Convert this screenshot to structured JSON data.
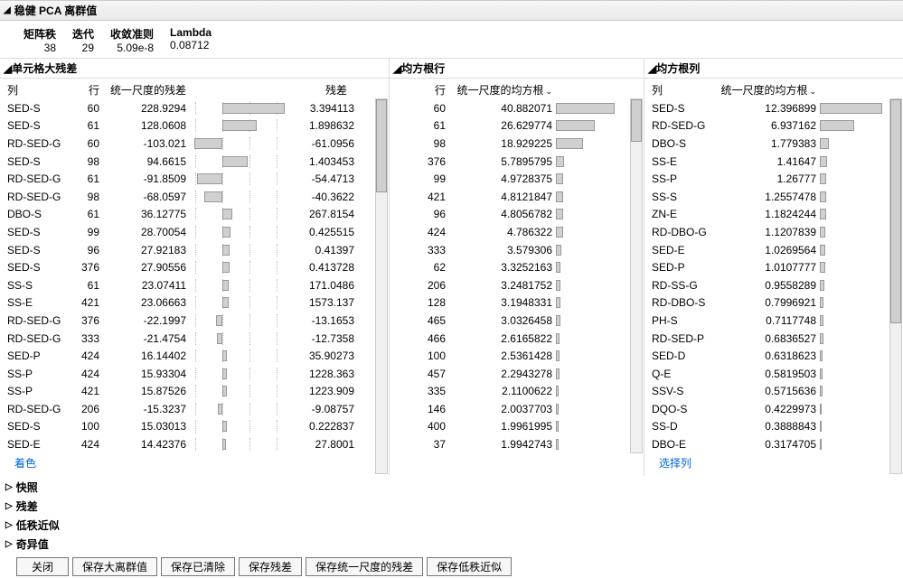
{
  "title": "稳健 PCA 离群值",
  "stats": {
    "matrix_rank_label": "矩阵秩",
    "iter_label": "迭代",
    "conv_label": "收敛准则",
    "lambda_label": "Lambda",
    "matrix_rank": "38",
    "iter": "29",
    "conv": "5.09e-8",
    "lambda": "0.08712"
  },
  "sectionA": {
    "header": "单元格大残差",
    "col1": "列",
    "col2": "行",
    "col3": "统一尺度的残差",
    "col4": "残差",
    "footer_link": "着色",
    "rows": [
      {
        "c": "SED-S",
        "r": "60",
        "v": "228.9294",
        "res": "3.394113"
      },
      {
        "c": "SED-S",
        "r": "61",
        "v": "128.0608",
        "res": "1.898632"
      },
      {
        "c": "RD-SED-G",
        "r": "60",
        "v": "-103.021",
        "res": "-61.0956"
      },
      {
        "c": "SED-S",
        "r": "98",
        "v": "94.6615",
        "res": "1.403453"
      },
      {
        "c": "RD-SED-G",
        "r": "61",
        "v": "-91.8509",
        "res": "-54.4713"
      },
      {
        "c": "RD-SED-G",
        "r": "98",
        "v": "-68.0597",
        "res": "-40.3622"
      },
      {
        "c": "DBO-S",
        "r": "61",
        "v": "36.12775",
        "res": "267.8154"
      },
      {
        "c": "SED-S",
        "r": "99",
        "v": "28.70054",
        "res": "0.425515"
      },
      {
        "c": "SED-S",
        "r": "96",
        "v": "27.92183",
        "res": "0.41397"
      },
      {
        "c": "SED-S",
        "r": "376",
        "v": "27.90556",
        "res": "0.413728"
      },
      {
        "c": "SS-S",
        "r": "61",
        "v": "23.07411",
        "res": "171.0486"
      },
      {
        "c": "SS-E",
        "r": "421",
        "v": "23.06663",
        "res": "1573.137"
      },
      {
        "c": "RD-SED-G",
        "r": "376",
        "v": "-22.1997",
        "res": "-13.1653"
      },
      {
        "c": "RD-SED-G",
        "r": "333",
        "v": "-21.4754",
        "res": "-12.7358"
      },
      {
        "c": "SED-P",
        "r": "424",
        "v": "16.14402",
        "res": "35.90273"
      },
      {
        "c": "SS-P",
        "r": "424",
        "v": "15.93304",
        "res": "1228.363"
      },
      {
        "c": "SS-P",
        "r": "421",
        "v": "15.87526",
        "res": "1223.909"
      },
      {
        "c": "RD-SED-G",
        "r": "206",
        "v": "-15.3237",
        "res": "-9.08757"
      },
      {
        "c": "SED-S",
        "r": "100",
        "v": "15.03013",
        "res": "0.222837"
      },
      {
        "c": "SED-E",
        "r": "424",
        "v": "14.42376",
        "res": "27.8001"
      }
    ]
  },
  "sectionB": {
    "header": "均方根行",
    "col1": "行",
    "col2": "统一尺度的均方根",
    "rows": [
      {
        "r": "60",
        "v": "40.882071"
      },
      {
        "r": "61",
        "v": "26.629774"
      },
      {
        "r": "98",
        "v": "18.929225"
      },
      {
        "r": "376",
        "v": "5.7895795"
      },
      {
        "r": "99",
        "v": "4.9728375"
      },
      {
        "r": "421",
        "v": "4.8121847"
      },
      {
        "r": "96",
        "v": "4.8056782"
      },
      {
        "r": "424",
        "v": "4.786322"
      },
      {
        "r": "333",
        "v": "3.579306"
      },
      {
        "r": "62",
        "v": "3.3252163"
      },
      {
        "r": "206",
        "v": "3.2481752"
      },
      {
        "r": "128",
        "v": "3.1948331"
      },
      {
        "r": "465",
        "v": "3.0326458"
      },
      {
        "r": "466",
        "v": "2.6165822"
      },
      {
        "r": "100",
        "v": "2.5361428"
      },
      {
        "r": "457",
        "v": "2.2943278"
      },
      {
        "r": "335",
        "v": "2.1100622"
      },
      {
        "r": "146",
        "v": "2.0037703"
      },
      {
        "r": "400",
        "v": "1.9961995"
      },
      {
        "r": "37",
        "v": "1.9942743"
      }
    ]
  },
  "sectionC": {
    "header": "均方根列",
    "col1": "列",
    "col2": "统一尺度的均方根",
    "footer_link": "选择列",
    "rows": [
      {
        "c": "SED-S",
        "v": "12.396899"
      },
      {
        "c": "RD-SED-G",
        "v": "6.937162"
      },
      {
        "c": "DBO-S",
        "v": "1.779383"
      },
      {
        "c": "SS-E",
        "v": "1.41647"
      },
      {
        "c": "SS-P",
        "v": "1.26777"
      },
      {
        "c": "SS-S",
        "v": "1.2557478"
      },
      {
        "c": "ZN-E",
        "v": "1.1824244"
      },
      {
        "c": "RD-DBO-G",
        "v": "1.1207839"
      },
      {
        "c": "SED-E",
        "v": "1.0269564"
      },
      {
        "c": "SED-P",
        "v": "1.0107777"
      },
      {
        "c": "RD-SS-G",
        "v": "0.9558289"
      },
      {
        "c": "RD-DBO-S",
        "v": "0.7996921"
      },
      {
        "c": "PH-S",
        "v": "0.7117748"
      },
      {
        "c": "RD-SED-P",
        "v": "0.6836527"
      },
      {
        "c": "SED-D",
        "v": "0.6318623"
      },
      {
        "c": "Q-E",
        "v": "0.5819503"
      },
      {
        "c": "SSV-S",
        "v": "0.5715636"
      },
      {
        "c": "DQO-S",
        "v": "0.4229973"
      },
      {
        "c": "SS-D",
        "v": "0.3888843"
      },
      {
        "c": "DBO-E",
        "v": "0.3174705"
      }
    ]
  },
  "collapsed": {
    "snapshot": "快照",
    "residual": "残差",
    "lowrank": "低秩近似",
    "singular": "奇异值"
  },
  "buttons": {
    "close": "关闭",
    "save_outliers": "保存大离群值",
    "save_cleaned": "保存已清除",
    "save_resid": "保存残差",
    "save_scaled": "保存统一尺度的残差",
    "save_lowrank": "保存低秩近似"
  },
  "chart_data": [
    {
      "type": "bar",
      "title": "单元格大残差 — 统一尺度的残差",
      "orientation": "horizontal",
      "xlim": [
        -120,
        240
      ],
      "series": [
        {
          "name": "统一尺度的残差",
          "categories": [
            "SED-S/60",
            "SED-S/61",
            "RD-SED-G/60",
            "SED-S/98",
            "RD-SED-G/61",
            "RD-SED-G/98",
            "DBO-S/61",
            "SED-S/99",
            "SED-S/96",
            "SED-S/376",
            "SS-S/61",
            "SS-E/421",
            "RD-SED-G/376",
            "RD-SED-G/333",
            "SED-P/424",
            "SS-P/424",
            "SS-P/421",
            "RD-SED-G/206",
            "SED-S/100",
            "SED-E/424"
          ],
          "values": [
            228.9294,
            128.0608,
            -103.021,
            94.6615,
            -91.8509,
            -68.0597,
            36.12775,
            28.70054,
            27.92183,
            27.90556,
            23.07411,
            23.06663,
            -22.1997,
            -21.4754,
            16.14402,
            15.93304,
            15.87526,
            -15.3237,
            15.03013,
            14.42376
          ]
        }
      ]
    },
    {
      "type": "bar",
      "title": "均方根行 — 统一尺度的均方根",
      "orientation": "horizontal",
      "xlim": [
        0,
        45
      ],
      "categories": [
        "60",
        "61",
        "98",
        "376",
        "99",
        "421",
        "96",
        "424",
        "333",
        "62",
        "206",
        "128",
        "465",
        "466",
        "100",
        "457",
        "335",
        "146",
        "400",
        "37"
      ],
      "values": [
        40.882071,
        26.629774,
        18.929225,
        5.7895795,
        4.9728375,
        4.8121847,
        4.8056782,
        4.786322,
        3.579306,
        3.3252163,
        3.2481752,
        3.1948331,
        3.0326458,
        2.6165822,
        2.5361428,
        2.2943278,
        2.1100622,
        2.0037703,
        1.9961995,
        1.9942743
      ]
    },
    {
      "type": "bar",
      "title": "均方根列 — 统一尺度的均方根",
      "orientation": "horizontal",
      "xlim": [
        0,
        13
      ],
      "categories": [
        "SED-S",
        "RD-SED-G",
        "DBO-S",
        "SS-E",
        "SS-P",
        "SS-S",
        "ZN-E",
        "RD-DBO-G",
        "SED-E",
        "SED-P",
        "RD-SS-G",
        "RD-DBO-S",
        "PH-S",
        "RD-SED-P",
        "SED-D",
        "Q-E",
        "SSV-S",
        "DQO-S",
        "SS-D",
        "DBO-E"
      ],
      "values": [
        12.396899,
        6.937162,
        1.779383,
        1.41647,
        1.26777,
        1.2557478,
        1.1824244,
        1.1207839,
        1.0269564,
        1.0107777,
        0.9558289,
        0.7996921,
        0.7117748,
        0.6836527,
        0.6318623,
        0.5819503,
        0.5715636,
        0.4229973,
        0.3888843,
        0.3174705
      ]
    }
  ]
}
